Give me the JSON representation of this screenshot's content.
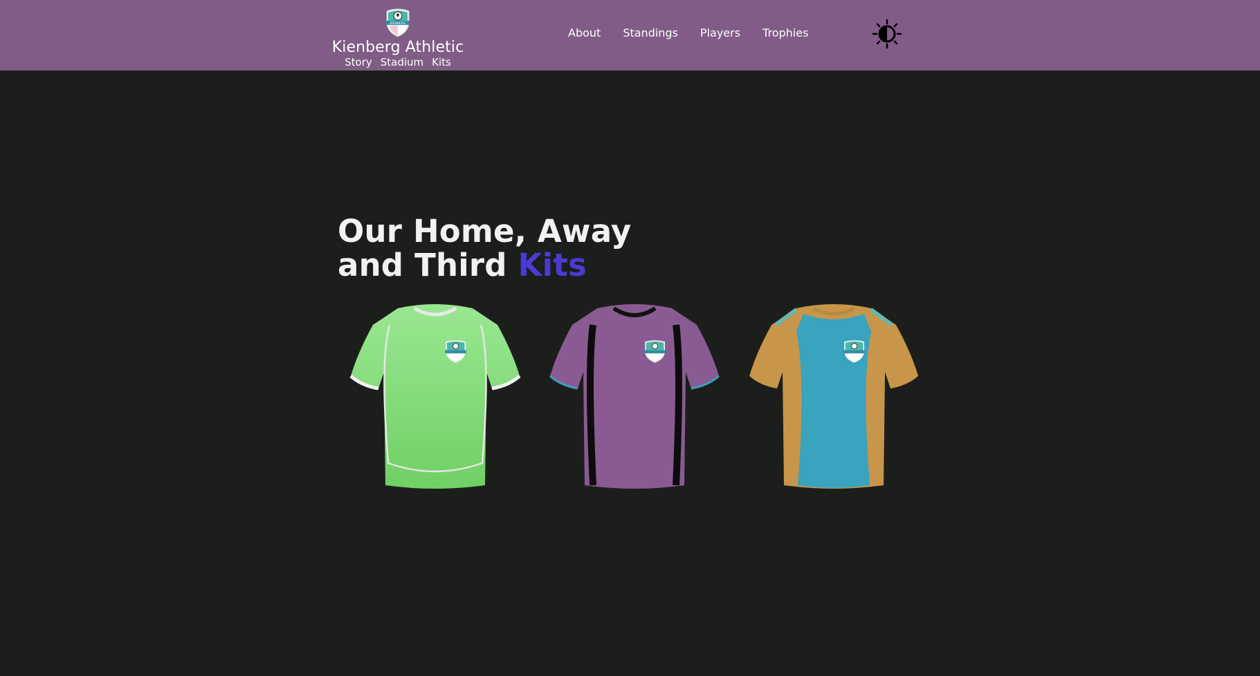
{
  "brand": {
    "name": "Kienberg Athletic",
    "crest_text": "KIENBERG",
    "links": [
      "Story",
      "Stadium",
      "Kits"
    ]
  },
  "nav": {
    "items": [
      "About",
      "Standings",
      "Players",
      "Trophies"
    ]
  },
  "theme_toggle": {
    "icon": "contrast-sun-icon"
  },
  "heading": {
    "line1": "Our Home, Away",
    "line2": "and Third",
    "accent": "Kits"
  },
  "kits": [
    {
      "name": "home-kit",
      "body_color": "#82d879",
      "trim_color": "#e6e6e6"
    },
    {
      "name": "away-kit",
      "body_color": "#8a5b92",
      "trim_color": "#111111"
    },
    {
      "name": "third-kit",
      "body_color": "#3aa3be",
      "trim_color": "#c7964a"
    }
  ],
  "colors": {
    "header_bg": "#805c86",
    "page_bg": "#1c1e1c",
    "accent": "#4b3bd1"
  }
}
